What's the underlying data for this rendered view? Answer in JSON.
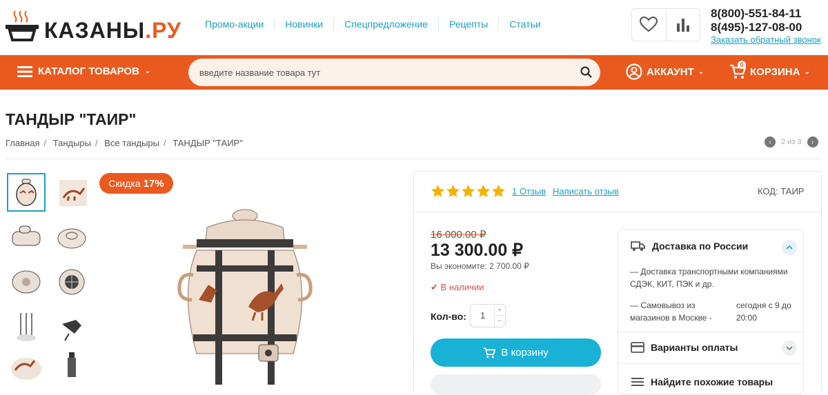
{
  "header": {
    "logo_text": "КАЗАНЫ",
    "logo_suffix": ".РУ",
    "nav": [
      "Промо-акции",
      "Новинки",
      "Спецпредложение",
      "Рецепты",
      "Статьи"
    ],
    "phone1": "8(800)-551-84-11",
    "phone2": "8(495)-127-08-00",
    "callback": "Заказать обратный звонок"
  },
  "bar": {
    "catalog": "КАТАЛОГ ТОВАРОВ",
    "search_placeholder": "введите название товара тут",
    "account": "АККАУНТ",
    "cart": "КОРЗИНА",
    "cart_count": "0"
  },
  "page": {
    "title": "ТАНДЫР \"ТАИР\"",
    "breadcrumbs": [
      "Главная",
      "Тандыры",
      "Все тандыры",
      "ТАНДЫР \"ТАИР\""
    ],
    "pager": "2 из 3"
  },
  "product": {
    "discount_label": "Скидка",
    "discount_value": "17%",
    "rating": 5,
    "reviews": "1 Отзыв",
    "write_review": "Написать отзыв",
    "code": "КОД: ТАИР",
    "old_price": "16 000.00 ₽",
    "price": "13 300.00 ₽",
    "savings": "Вы экономите: 2 700.00 ₽",
    "availability": "В наличии",
    "qty_label": "Кол-во:",
    "qty": "1",
    "buy": "В корзину"
  },
  "delivery": {
    "title": "Доставка по России",
    "line1": "— Доставка транспортными компаниями СДЭК, КИТ, ПЭК и др.",
    "line2": "— Самовывоз из магазинов в Москве -",
    "line3": "сегодня с 9 до 20:00",
    "payment": "Варианты оплаты",
    "similar": "Найдите похожие товары"
  },
  "colors": {
    "accent": "#ea5a1f",
    "link": "#1aa0c4",
    "button": "#19b1d6",
    "star": "#f5b400"
  }
}
